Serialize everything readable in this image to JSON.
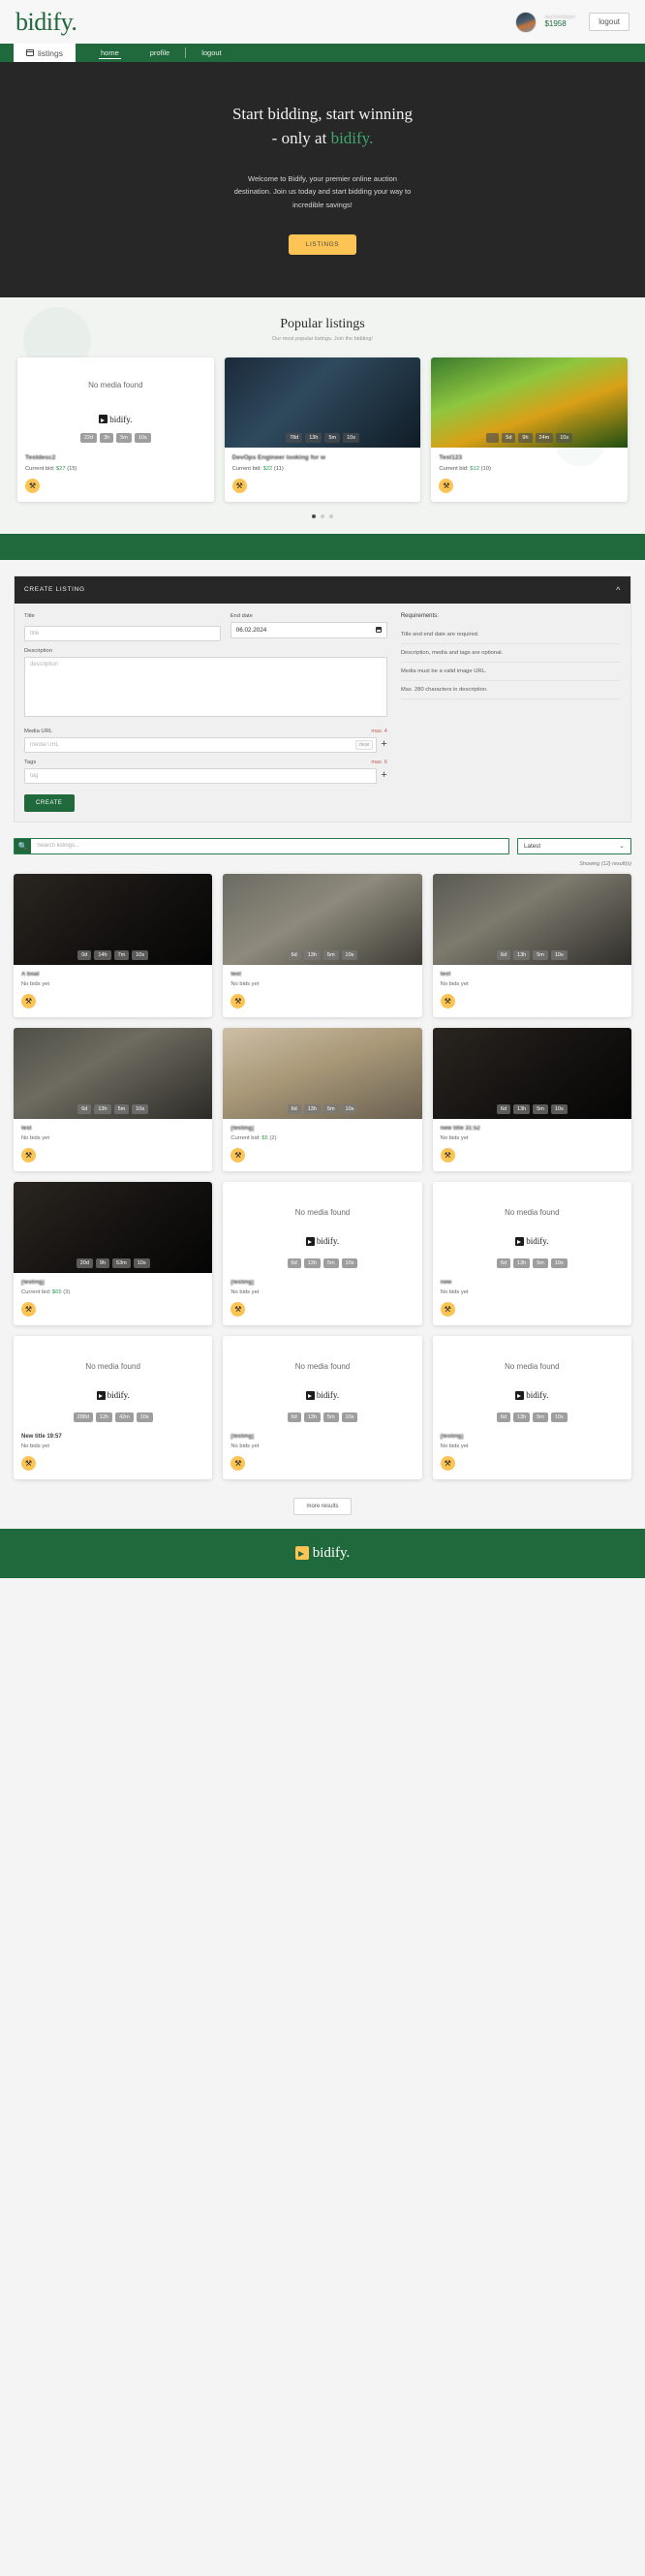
{
  "topbar": {
    "brand": "bidify.",
    "user_name": "auctionlogin",
    "balance": "$1958",
    "logout_label": "logout"
  },
  "navbar": {
    "brand_tab": "listings",
    "links": [
      {
        "label": "home",
        "active": true
      },
      {
        "label": "profile",
        "active": false
      },
      {
        "label": "logout",
        "active": false
      }
    ]
  },
  "hero": {
    "title_line1": "Start bidding, start winning",
    "title_line2_prefix": "- only at ",
    "title_line2_accent": "bidify.",
    "paragraph": "Welcome to Bidify, your premier online auction destination. Join us today and start bidding your way to incredible savings!",
    "button_label": "LISTINGS"
  },
  "popular": {
    "heading": "Popular listings",
    "subheading": "Our most popular listings. Join the bidding!",
    "cards": [
      {
        "media": "none",
        "no_media_label": "No media found",
        "logo_text": "bidify.",
        "timers": [
          "22d",
          "3h",
          "5m",
          "10s"
        ],
        "title": "Testdesc2",
        "bid_label": "Current bid:",
        "bid_amount": "$27",
        "bid_count": "(15)",
        "gavel": "gavel-icon"
      },
      {
        "media": "photo",
        "timers": [
          "78d",
          "13h",
          "5m",
          "10s"
        ],
        "title": "DevOps Engineer looking for w",
        "bid_label": "Current bid:",
        "bid_amount": "$22",
        "bid_count": "(11)",
        "gavel": "gavel-icon"
      },
      {
        "media": "photo",
        "timers": [
          "",
          "5d",
          "9h",
          "24m",
          "10s"
        ],
        "title": "Test123",
        "bid_label": "Current bid:",
        "bid_amount": "$12",
        "bid_count": "(10)",
        "gavel": "gavel-icon"
      }
    ],
    "dots": [
      true,
      false,
      false
    ]
  },
  "create_listing": {
    "panel_title": "CREATE LISTING",
    "collapse_icon": "chevron-up-icon",
    "title_label": "Title",
    "title_placeholder": "title",
    "title_value": "",
    "end_date_label": "End date",
    "end_date_value": "06.02.2024",
    "description_label": "Description",
    "description_placeholder": "description",
    "description_value": "",
    "media_label": "Media URL",
    "media_max": "max. 4",
    "media_placeholder": "media URL",
    "media_value": "",
    "media_clear_label": "clear",
    "media_add_label": "+",
    "tags_label": "Tags",
    "tags_max": "max. 6",
    "tags_placeholder": "tag",
    "tags_value": "",
    "tags_add_label": "+",
    "create_button": "CREATE",
    "requirements_title": "Requirements:",
    "requirements": [
      "Title and end date are required.",
      "Description, media and tags are optional.",
      "Media must be a valid image URL.",
      "Max. 280 characters in description."
    ]
  },
  "search": {
    "icon": "search-icon",
    "placeholder": "Search listings...",
    "value": "",
    "sort_value": "Latest",
    "sort_chevron": "chevron-down-icon",
    "result_count": "Showing (12) result(s)"
  },
  "listings": [
    {
      "media": "photo",
      "ph": "ph8",
      "timers": [
        "0d",
        "14h",
        "7m",
        "10s"
      ],
      "title": "A boat",
      "bid_text": "No bids yet",
      "gavel": "gavel-icon"
    },
    {
      "media": "photo",
      "ph": "ph4",
      "timers": [
        "6d",
        "13h",
        "5m",
        "10s"
      ],
      "title": "test",
      "bid_text": "No bids yet",
      "gavel": "gavel-icon"
    },
    {
      "media": "photo",
      "ph": "ph5",
      "timers": [
        "6d",
        "13h",
        "5m",
        "10s"
      ],
      "title": "test",
      "bid_text": "No bids yet",
      "gavel": "gavel-icon"
    },
    {
      "media": "photo",
      "ph": "ph6",
      "timers": [
        "6d",
        "13h",
        "5m",
        "10s"
      ],
      "title": "test",
      "bid_text": "No bids yet",
      "gavel": "gavel-icon"
    },
    {
      "media": "photo",
      "ph": "ph7",
      "timers": [
        "6d",
        "13h",
        "5m",
        "10s"
      ],
      "title": "[testing]",
      "bid_text": "Current bid: ",
      "bid_amount": "$5",
      "bid_count": "(2)",
      "gavel": "gavel-icon"
    },
    {
      "media": "photo",
      "ph": "ph8",
      "timers": [
        "6d",
        "13h",
        "5m",
        "10s"
      ],
      "title": "new title 31:52",
      "bid_text": "No bids yet",
      "gavel": "gavel-icon"
    },
    {
      "media": "photo",
      "ph": "ph8",
      "timers": [
        "20d",
        "9h",
        "53m",
        "10s"
      ],
      "title": "[testing]",
      "bid_text": "Current bid: ",
      "bid_amount": "$65",
      "bid_count": "(3)",
      "gavel": "gavel-icon"
    },
    {
      "media": "none",
      "no_media_label": "No media found",
      "logo_text": "bidify.",
      "timers": [
        "6d",
        "13h",
        "5m",
        "10s"
      ],
      "title": "[testing]",
      "bid_text": "No bids yet",
      "gavel": "gavel-icon"
    },
    {
      "media": "none",
      "no_media_label": "No media found",
      "logo_text": "bidify.",
      "timers": [
        "6d",
        "13h",
        "5m",
        "10s"
      ],
      "title": "new",
      "bid_text": "No bids yet",
      "gavel": "gavel-icon"
    },
    {
      "media": "none",
      "no_media_label": "No media found",
      "logo_text": "bidify.",
      "timers": [
        "288d",
        "12h",
        "42m",
        "10s"
      ],
      "title": "New title 19:57",
      "bid_text": "No bids yet",
      "gavel": "gavel-icon"
    },
    {
      "media": "none",
      "no_media_label": "No media found",
      "logo_text": "bidify.",
      "timers": [
        "6d",
        "13h",
        "5m",
        "10s"
      ],
      "title": "[testing]",
      "bid_text": "No bids yet",
      "gavel": "gavel-icon"
    },
    {
      "media": "none",
      "no_media_label": "No media found",
      "logo_text": "bidify.",
      "timers": [
        "6d",
        "13h",
        "5m",
        "10s"
      ],
      "title": "[testing]",
      "bid_text": "No bids yet",
      "gavel": "gavel-icon"
    }
  ],
  "more_results_label": "more results",
  "footer": {
    "brand": "bidify."
  },
  "colors": {
    "brand_green": "#20693c",
    "accent_green": "#3fa86a",
    "amber": "#fcc455",
    "dark": "#272727"
  }
}
